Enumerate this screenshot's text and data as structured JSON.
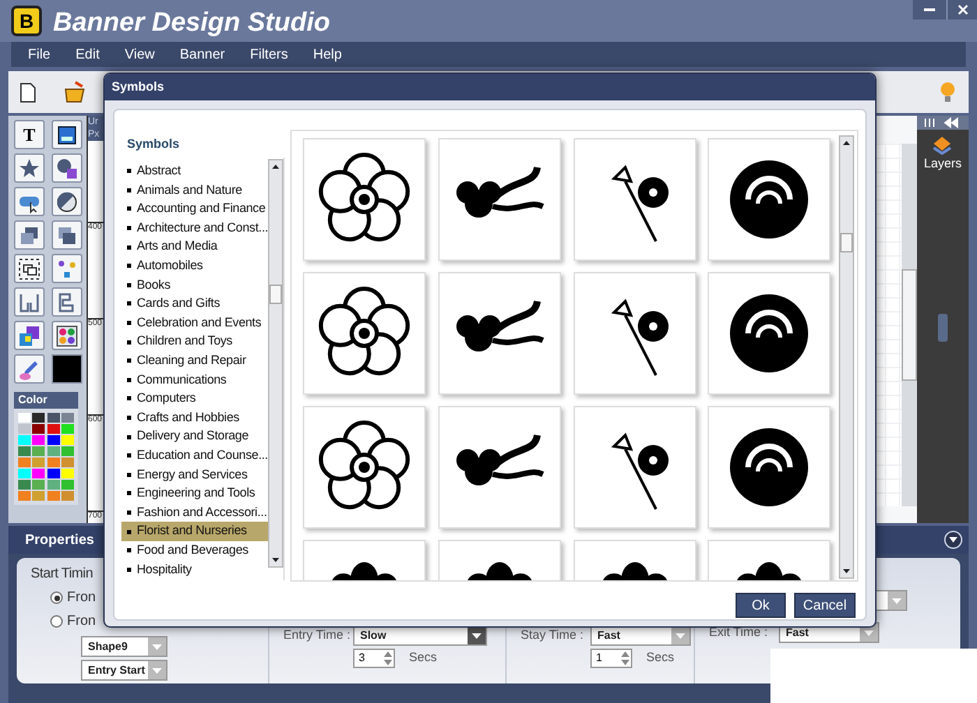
{
  "app": {
    "logo_letter": "B",
    "title": "Banner Design Studio"
  },
  "menu": [
    "File",
    "Edit",
    "View",
    "Banner",
    "Filters",
    "Help"
  ],
  "tools": [
    {
      "kind": "text",
      "label": "T"
    },
    {
      "kind": "image"
    },
    {
      "kind": "star"
    },
    {
      "kind": "shapes"
    },
    {
      "kind": "button"
    },
    {
      "kind": "circle"
    },
    {
      "kind": "send-back"
    },
    {
      "kind": "bring-front"
    },
    {
      "kind": "group"
    },
    {
      "kind": "dots"
    },
    {
      "kind": "align"
    },
    {
      "kind": "layout"
    },
    {
      "kind": "squares"
    },
    {
      "kind": "pattern"
    },
    {
      "kind": "eyedropper"
    },
    {
      "kind": "swatch",
      "color": "#000000"
    }
  ],
  "color_panel": {
    "title": "Color",
    "swatches": [
      {
        "color": "#ffffff"
      },
      {
        "color": "#2a2a2a"
      },
      {
        "color": "#4a5668"
      },
      {
        "color": "#7a8494"
      },
      {
        "color": "#c0c4cc"
      },
      {
        "color": "#8b0000"
      },
      {
        "color": "#e01010"
      },
      {
        "color": "#20e020"
      },
      {
        "color": "#00ffff"
      },
      {
        "color": "#ff00ff"
      },
      {
        "color": "#0000ff"
      },
      {
        "color": "#ffff00"
      },
      {
        "color": "#3a8a50"
      },
      {
        "color": "#5ab050"
      },
      {
        "color": "#60b080"
      },
      {
        "color": "#30c030"
      },
      {
        "color": "#f08020"
      },
      {
        "color": "#d0a030"
      },
      {
        "color": "#f08020"
      },
      {
        "color": "#d09030"
      },
      {
        "color": "#00ffff"
      },
      {
        "color": "#ff00ff"
      },
      {
        "color": "#0000ff"
      },
      {
        "color": "#ffff00"
      },
      {
        "color": "#3a8a50"
      },
      {
        "color": "#5ab050"
      },
      {
        "color": "#60b080"
      },
      {
        "color": "#30c030"
      },
      {
        "color": "#f08020"
      },
      {
        "color": "#d0a030"
      },
      {
        "color": "#f08020"
      },
      {
        "color": "#d09030"
      }
    ]
  },
  "ruler": {
    "header": [
      "Ur",
      "Px"
    ],
    "marks": [
      "400",
      "500",
      "600",
      "700"
    ]
  },
  "layers_panel": {
    "label": "Layers"
  },
  "properties": {
    "title": "Properties",
    "start_timing_label": "Start Timin",
    "radios": [
      {
        "label": "Fron",
        "selected": true
      },
      {
        "label": "Fron",
        "selected": false
      }
    ],
    "selects": [
      "Shape9",
      "Entry Start"
    ],
    "entry": {
      "label": "Entry Time :",
      "speed": "Slow",
      "focused": true,
      "secs": "3",
      "unit": "Secs"
    },
    "stay": {
      "label": "Stay Time :",
      "speed": "Fast",
      "secs": "1",
      "unit": "Secs"
    },
    "exit": {
      "label": "Exit Time :",
      "speed": "Fast"
    }
  },
  "dialog": {
    "title": "Symbols",
    "heading": "Symbols",
    "categories": [
      {
        "label": "Abstract",
        "selected": false
      },
      {
        "label": "Animals and Nature",
        "selected": false
      },
      {
        "label": "Accounting and Finance",
        "selected": false
      },
      {
        "label": "Architecture and Const...",
        "selected": false
      },
      {
        "label": "Arts and Media",
        "selected": false
      },
      {
        "label": "Automobiles",
        "selected": false
      },
      {
        "label": "Books",
        "selected": false
      },
      {
        "label": "Cards and Gifts",
        "selected": false
      },
      {
        "label": "Celebration and Events",
        "selected": false
      },
      {
        "label": "Children and Toys",
        "selected": false
      },
      {
        "label": "Cleaning and Repair",
        "selected": false
      },
      {
        "label": "Communications",
        "selected": false
      },
      {
        "label": "Computers",
        "selected": false
      },
      {
        "label": "Crafts and Hobbies",
        "selected": false
      },
      {
        "label": "Delivery and Storage",
        "selected": false
      },
      {
        "label": "Education and Counse...",
        "selected": false
      },
      {
        "label": "Energy and Services",
        "selected": false
      },
      {
        "label": "Engineering and Tools",
        "selected": false
      },
      {
        "label": "Fashion and Accessori...",
        "selected": false
      },
      {
        "label": "Florist and Nurseries",
        "selected": true
      },
      {
        "label": "Food and Beverages",
        "selected": false
      },
      {
        "label": "Hospitality",
        "selected": false
      }
    ],
    "buttons": [
      "Ok",
      "Cancel"
    ]
  }
}
